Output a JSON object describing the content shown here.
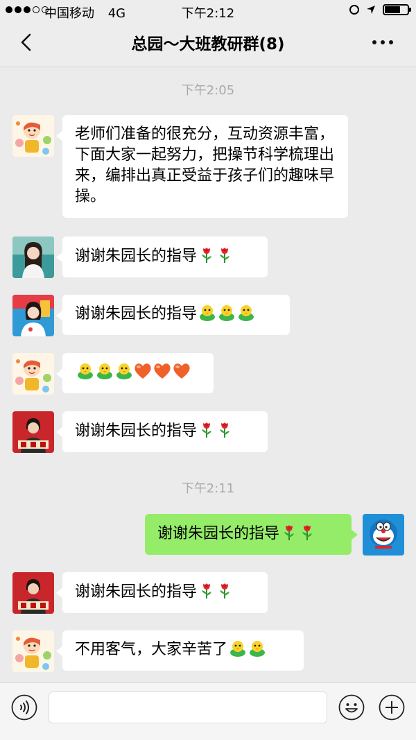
{
  "status_bar": {
    "carrier": "中国移动",
    "network": "4G",
    "time": "下午2:12"
  },
  "nav": {
    "title": "总园～大班教研群(8)"
  },
  "chat": {
    "time1": "下午2:05",
    "time2": "下午2:11",
    "messages": [
      {
        "text": "老师们准备的很充分，互动资源丰富，下面大家一起努力，把操节科学梳理出来，编排出真正受益于孩子们的趣味早操。"
      },
      {
        "text": "谢谢朱园长的指导"
      },
      {
        "text": "谢谢朱园长的指导"
      },
      {
        "text": ""
      },
      {
        "text": "谢谢朱园长的指导"
      },
      {
        "text": "谢谢朱园长的指导"
      },
      {
        "text": "谢谢朱园长的指导"
      },
      {
        "text": "不用客气，大家辛苦了"
      }
    ]
  },
  "input_bar": {
    "value": ""
  },
  "colors": {
    "background": "#ebebeb",
    "my_bubble": "#95ec69",
    "their_bubble": "#ffffff"
  },
  "icons": [
    "back-icon",
    "more-icon",
    "voice-icon",
    "emoji-icon",
    "plus-icon",
    "rose-emoji",
    "chick-emoji",
    "heart-emoji"
  ]
}
